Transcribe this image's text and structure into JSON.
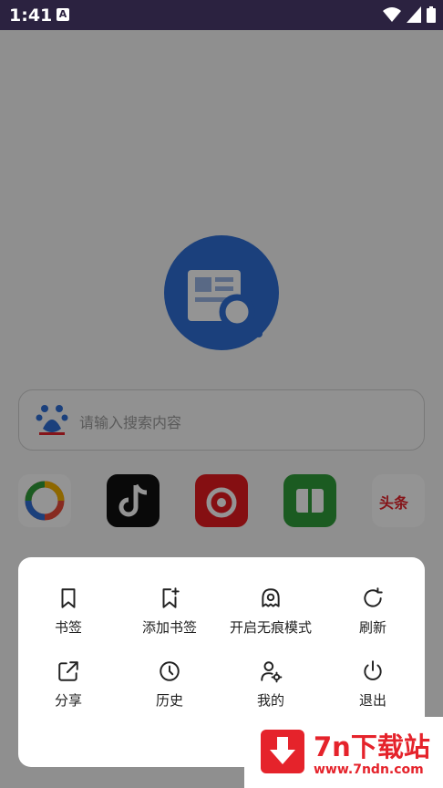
{
  "status_bar": {
    "time": "1:41",
    "a_badge": "A"
  },
  "search": {
    "placeholder": "请输入搜索内容"
  },
  "shortcuts": [
    {
      "icon": "pinwheel-app-icon",
      "color": "#ffffff"
    },
    {
      "icon": "douyin-app-icon",
      "color": "#111111"
    },
    {
      "icon": "netease-music-app-icon",
      "color": "#e51b20"
    },
    {
      "icon": "green-book-app-icon",
      "color": "#2f9e3a"
    },
    {
      "icon": "toutiao-app-icon",
      "color": "#ffffff",
      "label": "头条"
    }
  ],
  "menu": {
    "items": [
      {
        "label": "书签",
        "icon": "bookmark-icon"
      },
      {
        "label": "添加书签",
        "icon": "add-bookmark-icon"
      },
      {
        "label": "开启无痕模式",
        "icon": "incognito-icon"
      },
      {
        "label": "刷新",
        "icon": "refresh-icon"
      },
      {
        "label": "分享",
        "icon": "share-icon"
      },
      {
        "label": "历史",
        "icon": "history-icon"
      },
      {
        "label": "我的",
        "icon": "user-settings-icon"
      },
      {
        "label": "退出",
        "icon": "power-icon"
      }
    ]
  },
  "watermark": {
    "title": "7n下载站",
    "url": "www.7ndn.com"
  },
  "colors": {
    "accent": "#2f6fd6",
    "statusbar": "#2b2240",
    "watermark": "#e5232b"
  }
}
